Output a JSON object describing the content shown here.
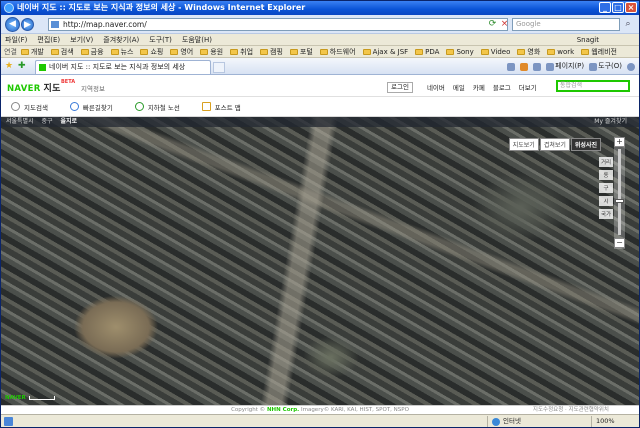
{
  "window": {
    "title": "네이버 지도 :: 지도로 보는 지식과 정보의 세상 - Windows Internet Explorer"
  },
  "address_bar": {
    "url": "http://map.naver.com/",
    "search_placeholder": "Google"
  },
  "menu": {
    "items": [
      "파일(F)",
      "편집(E)",
      "보기(V)",
      "즐겨찾기(A)",
      "도구(T)",
      "도움말(H)"
    ],
    "snagit_label": "Snagit"
  },
  "links_bar": {
    "label": "연결",
    "folders": [
      "개발",
      "검색",
      "금융",
      "뉴스",
      "쇼핑",
      "영어",
      "용원",
      "취업",
      "캠핑",
      "포털",
      "하드웨어",
      "Ajax & JSF",
      "PDA",
      "Sony",
      "Video",
      "영화",
      "work",
      "웹레비전"
    ]
  },
  "tabbar": {
    "tab_title": "네이버 지도 :: 지도로 보는 지식과 정보의 세상",
    "commands": [
      "페이지(P)",
      "도구(O)"
    ]
  },
  "naver": {
    "logo": "NAVER",
    "logo_map": "지도",
    "beta": "BETA",
    "region_label": "지역정보",
    "top_nav": [
      "로그인",
      "네이버",
      "메일",
      "카페",
      "블로그",
      "더보기"
    ],
    "search_placeholder": "통합검색",
    "tools": [
      "지도검색",
      "빠른길찾기",
      "지하철 노선",
      "포스트 맵"
    ],
    "breadcrumb": [
      "서울특별시",
      "중구",
      "을지로"
    ],
    "map_util": "My 즐겨찾기",
    "map_types": [
      "지도보기",
      "겹쳐보기",
      "위성사진"
    ],
    "active_map_type": "위성사진",
    "zoom_labels": [
      "거리",
      "동",
      "구",
      "시",
      "국가"
    ],
    "zoom_plus": "+",
    "zoom_minus": "−",
    "scale_logo": "NAVER",
    "footer_copyright": "Copyright ©",
    "footer_company": "NHN Corp.",
    "footer_imagery": "Imagery© KARI, KAI, HIST, SPOT, NSPO",
    "footer_links": "지도수정요청 · 지도관련협약위치"
  },
  "status_bar": {
    "zone": "인터넷",
    "zoom": "100%"
  },
  "colors": {
    "titlebar": "#0a53d6",
    "naver_green": "#1ec800",
    "map_bar": "#232832"
  }
}
